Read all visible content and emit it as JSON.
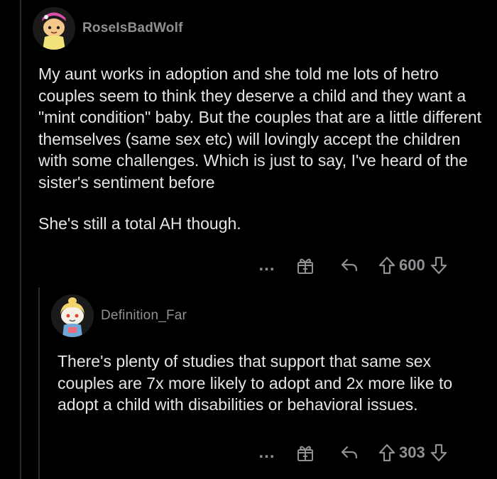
{
  "comments": [
    {
      "username": "RoseIsBadWolf",
      "paragraphs": [
        "My aunt works in adoption and she told me lots of hetro couples seem to think they deserve a child and they want a \"mint condition\" baby. But the couples that are a little different themselves (same sex etc) will lovingly accept the children with some challenges. Which is just to say, I've heard of the sister's sentiment before",
        "She's still a total AH though."
      ],
      "score": "600",
      "more_label": "..."
    },
    {
      "username": "Definition_Far",
      "paragraphs": [
        "There's plenty of studies that support that same sex couples are 7x more likely to adopt and 2x more like to adopt a child with disabilities or behavioral issues."
      ],
      "score": "303",
      "more_label": "..."
    }
  ],
  "icons": {
    "more": "more-icon",
    "gift": "gift-icon",
    "reply": "reply-icon",
    "upvote": "upvote-icon",
    "downvote": "downvote-icon"
  },
  "colors": {
    "background": "#000000",
    "text": "#e3e5e7",
    "muted": "#8e9194",
    "thread_line": "#2a2a2a"
  }
}
